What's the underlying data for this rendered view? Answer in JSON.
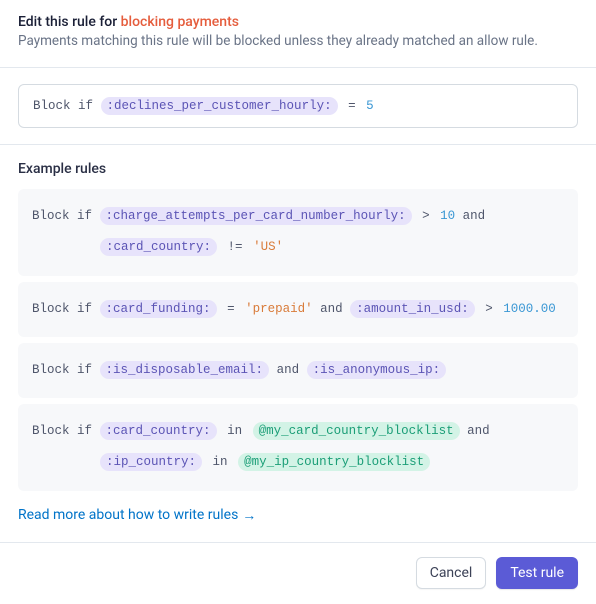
{
  "header": {
    "title_prefix": "Edit this rule for ",
    "title_highlight": "blocking payments",
    "subtitle": "Payments matching this rule will be blocked unless they already matched an allow rule."
  },
  "editor": {
    "keyword": "Block if",
    "attr": ":declines_per_customer_hourly:",
    "op": "=",
    "value": "5"
  },
  "examples_heading": "Example rules",
  "examples": {
    "ex1": {
      "kw": "Block if",
      "attr1": ":charge_attempts_per_card_number_hourly:",
      "op1": ">",
      "val1": "10",
      "and1": "and",
      "attr2": ":card_country:",
      "op2": "!=",
      "val2": "'US'"
    },
    "ex2": {
      "kw": "Block if",
      "attr1": ":card_funding:",
      "op1": "=",
      "val1": "'prepaid'",
      "and1": "and",
      "attr2": ":amount_in_usd:",
      "op2": ">",
      "val2": "1000.00"
    },
    "ex3": {
      "kw": "Block if",
      "attr1": ":is_disposable_email:",
      "and1": "and",
      "attr2": ":is_anonymous_ip:"
    },
    "ex4": {
      "kw": "Block if",
      "attr1": ":card_country:",
      "op1": "in",
      "list1": "@my_card_country_blocklist",
      "and1": "and",
      "attr2": ":ip_country:",
      "op2": "in",
      "list2": "@my_ip_country_blocklist"
    }
  },
  "link": {
    "text": "Read more about how to write rules",
    "arrow": "→"
  },
  "footer": {
    "cancel": "Cancel",
    "test": "Test rule"
  }
}
